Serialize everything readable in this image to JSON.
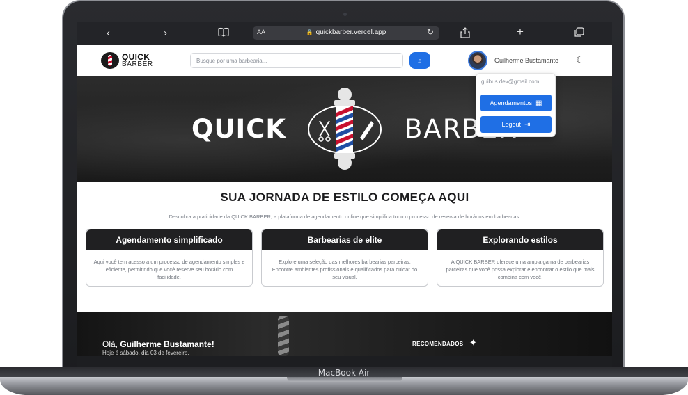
{
  "browser": {
    "url_aa": "AA",
    "url": "quickbarber.vercel.app",
    "icons": {
      "back": "chevron-left",
      "forward": "chevron-right",
      "reader": "book",
      "share": "share",
      "new_tab": "plus",
      "tabs": "tabs"
    }
  },
  "header": {
    "logo_quick": "QUICK",
    "logo_barber": "BARBER",
    "search_placeholder": "Busque por uma barbearia...",
    "user_name": "Guilherme Bustamante"
  },
  "dropdown": {
    "email": "guibus.dev@gmail.com",
    "bookings_label": "Agendamentos",
    "logout_label": "Logout"
  },
  "hero": {
    "word_left": "QUICK",
    "word_right": "BARBER"
  },
  "main": {
    "title": "SUA JORNADA DE ESTILO COMEÇA AQUI",
    "subtitle": "Descubra a praticidade da QUICK BARBER, a plataforma de agendamento online que simplifica todo o processo de reserva de horários em barbearias.",
    "cards": [
      {
        "title": "Agendamento simplificado",
        "text": "Aqui você tem acesso a um processo de agendamento simples e eficiente, permitindo que você reserve seu horário com facilidade."
      },
      {
        "title": "Barbearias de elite",
        "text": "Explore uma seleção das melhores barbearias parceiras. Encontre ambientes profissionais e qualificados para cuidar do seu visual."
      },
      {
        "title": "Explorando estilos",
        "text": "A QUICK BARBER oferece uma ampla gama de barbearias parceiras que você possa explorar e encontrar o estilo que mais combina com você."
      }
    ]
  },
  "bottom": {
    "greeting_prefix": "Olá, ",
    "greeting_name": "Guilherme Bustamante!",
    "date": "Hoje é sábado, dia 03 de fevereiro.",
    "recommended": "RECOMENDADOS"
  },
  "device": {
    "model": "MacBook Air"
  },
  "colors": {
    "accent": "#1f6fe5",
    "card_header": "#202022",
    "pole_red": "#c8102e"
  }
}
